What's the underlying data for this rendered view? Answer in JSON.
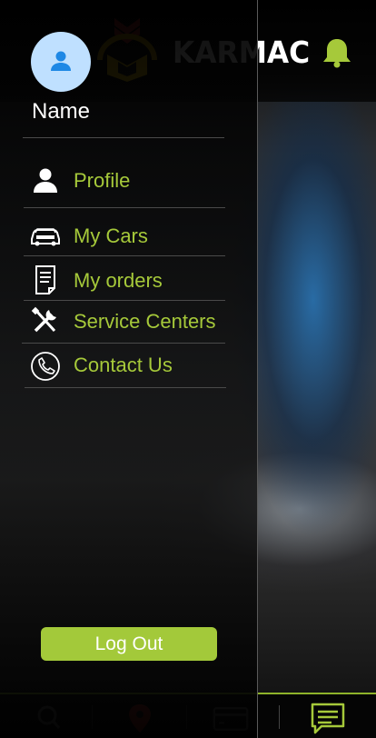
{
  "header": {
    "brand": "KARMAC",
    "logo_icon": "karmac-shield-logo",
    "bell_icon": "bell-icon"
  },
  "drawer": {
    "user_name": "Name",
    "avatar_icon": "person-icon",
    "menu": [
      {
        "label": "Profile",
        "icon": "person-icon"
      },
      {
        "label": "My Cars",
        "icon": "car-icon"
      },
      {
        "label": "My orders",
        "icon": "document-icon"
      },
      {
        "label": "Service Centers",
        "icon": "tools-icon"
      },
      {
        "label": "Contact Us",
        "icon": "phone-icon"
      }
    ],
    "logout_label": "Log Out"
  },
  "bottom_nav": {
    "items": [
      {
        "icon": "search-icon"
      },
      {
        "icon": "map-pin-icon"
      },
      {
        "icon": "card-icon"
      },
      {
        "icon": "chat-icon"
      }
    ]
  },
  "colors": {
    "accent": "#a6c93a",
    "avatar_bg": "#bfe0ff",
    "avatar_icon": "#1e88e5",
    "logo_red": "#c62828",
    "logo_yellow": "#e0b800"
  }
}
